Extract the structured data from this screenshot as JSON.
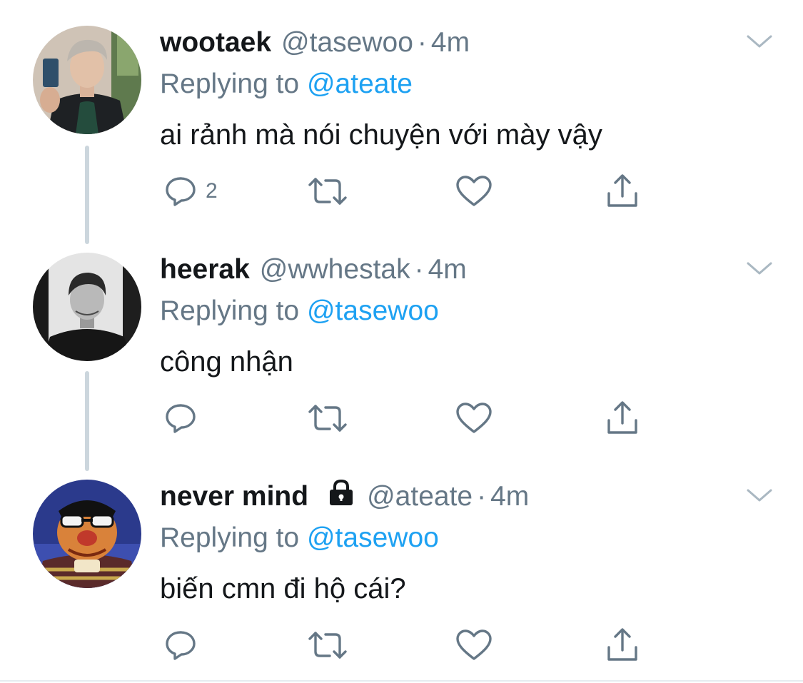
{
  "tweets": [
    {
      "name": "wootaek",
      "handle": "@tasewoo",
      "dot": "·",
      "time": "4m",
      "replying_prefix": "Replying to",
      "replying_to": "@ateate",
      "text": "ai rảnh mà nói chuyện với mày vậy",
      "reply_count": "2",
      "protected": false,
      "avatar_icon": "profile-photo-selfie"
    },
    {
      "name": "heerak",
      "handle": "@wwhestak",
      "dot": "·",
      "time": "4m",
      "replying_prefix": "Replying to",
      "replying_to": "@tasewoo",
      "text": "công nhận",
      "reply_count": "",
      "protected": false,
      "avatar_icon": "profile-photo-portrait"
    },
    {
      "name": "never mind",
      "handle": "@ateate",
      "dot": "·",
      "time": "4m",
      "replying_prefix": "Replying to",
      "replying_to": "@tasewoo",
      "text": "biến cmn đi hộ cái?",
      "reply_count": "",
      "protected": true,
      "avatar_icon": "profile-photo-puppet"
    }
  ],
  "icons": {
    "reply": "reply-icon",
    "retweet": "retweet-icon",
    "like": "like-icon",
    "share": "share-icon",
    "more": "chevron-down-icon",
    "protected": "lock-icon"
  },
  "colors": {
    "text": "#14171a",
    "secondary": "#657786",
    "link": "#1da1f2",
    "thread_line": "#ccd6dd",
    "action_icon": "#657786"
  }
}
